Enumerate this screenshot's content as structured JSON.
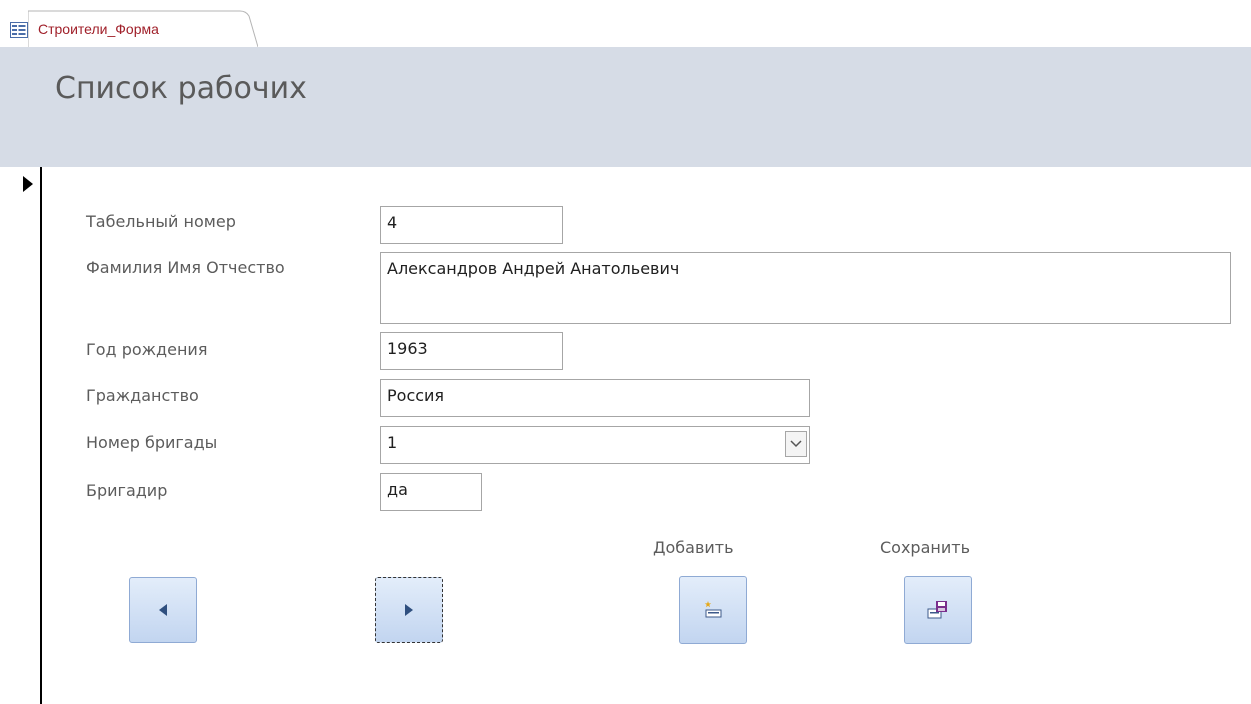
{
  "tab": {
    "label": "Строители_Форма",
    "icon": "form-icon"
  },
  "header": {
    "title": "Список рабочих"
  },
  "form": {
    "fields": [
      {
        "label": "Табельный номер",
        "value": "4"
      },
      {
        "label": "Фамилия Имя Отчество",
        "value": "Александров Андрей Анатольевич"
      },
      {
        "label": "Год рождения",
        "value": "1963"
      },
      {
        "label": "Гражданство",
        "value": "Россия"
      },
      {
        "label": "Номер бригады",
        "value": "1"
      },
      {
        "label": "Бригадир",
        "value": "да"
      }
    ]
  },
  "buttons": {
    "prev_icon": "triangle-left-icon",
    "next_icon": "triangle-right-icon",
    "add_label": "Добавить",
    "add_icon": "new-record-icon",
    "save_label": "Сохранить",
    "save_icon": "save-icon"
  },
  "colors": {
    "header_bg": "#d6dce6",
    "tab_text": "#a0202a",
    "button_bg": "#c2d5f0"
  }
}
